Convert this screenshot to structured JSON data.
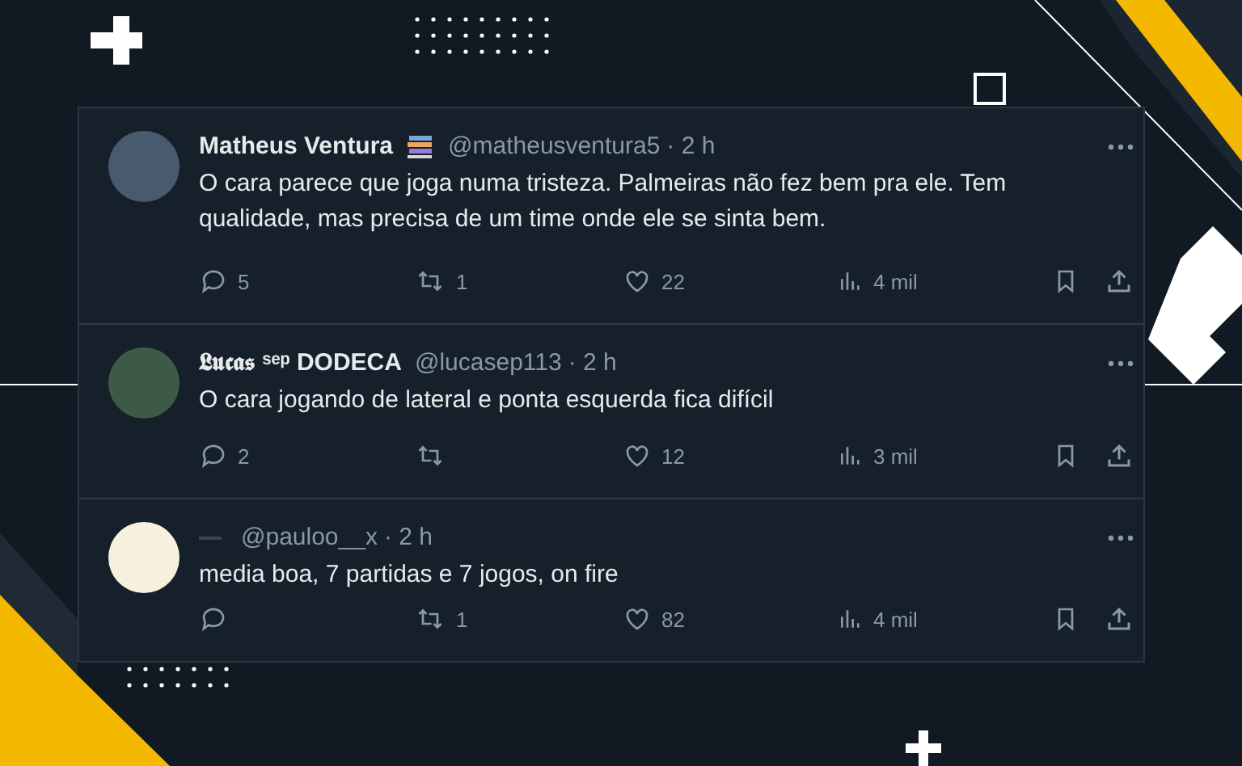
{
  "tweets": [
    {
      "avatar": {
        "color": "#4a5a6e"
      },
      "name": "Matheus Ventura",
      "has_badge": true,
      "handle": "@matheusventura5",
      "time": "· 2 h",
      "text": "O cara parece que joga numa tristeza. Palmeiras não fez bem pra ele. Tem qualidade, mas precisa de um time onde ele se sinta bem.",
      "replies": "5",
      "retweets": "1",
      "likes": "22",
      "views": "4 mil"
    },
    {
      "avatar": {
        "color": "#3d5a48"
      },
      "name": "𝕷𝖚𝖈𝖆𝖘 ˢᵉᵖ DODECA",
      "has_badge": false,
      "handle": "@lucasep113",
      "time": "· 2 h",
      "text": "O cara jogando de lateral e ponta esquerda fica difícil",
      "replies": "2",
      "likes": "12",
      "views": "3 mil"
    },
    {
      "avatar": {
        "color": "#f6f0de"
      },
      "has_badge": false,
      "handle": "@pauloo__x",
      "time": "· 2 h",
      "text": "media boa, 7 partidas e 7 jogos, on fire",
      "retweets": "1",
      "likes": "82",
      "views": "4 mil"
    }
  ]
}
